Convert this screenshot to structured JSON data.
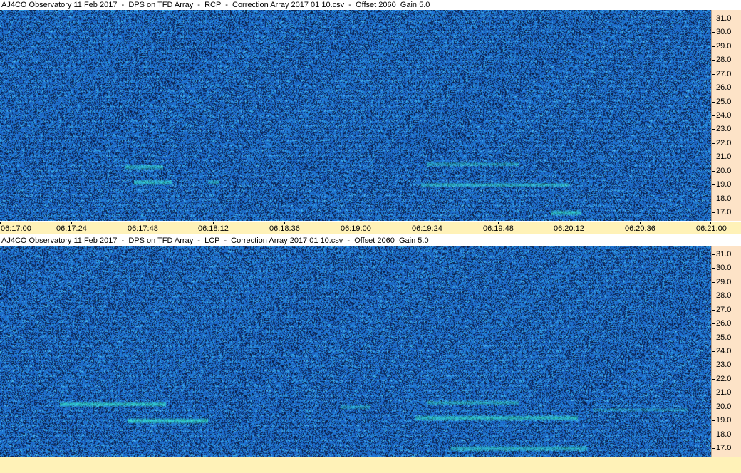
{
  "panels": [
    {
      "title": "AJ4CO Observatory 11 Feb 2017  -  DPS on TFD Array  -  RCP  -  Correction Array 2017 01 10.csv  -  Offset 2060  Gain 5.0",
      "polarization": "RCP",
      "show_time_labels": true,
      "bands": [
        {
          "freq": 20.3,
          "t_start": "06:17:42",
          "t_end": "06:17:55",
          "strength": 0.7
        },
        {
          "freq": 19.2,
          "t_start": "06:17:45",
          "t_end": "06:17:58",
          "strength": 0.8
        },
        {
          "freq": 19.2,
          "t_start": "06:18:10",
          "t_end": "06:18:14",
          "strength": 0.6
        },
        {
          "freq": 20.5,
          "t_start": "06:19:24",
          "t_end": "06:19:55",
          "strength": 0.5
        },
        {
          "freq": 19.0,
          "t_start": "06:19:22",
          "t_end": "06:20:12",
          "strength": 0.6
        },
        {
          "freq": 17.0,
          "t_start": "06:20:06",
          "t_end": "06:20:16",
          "strength": 0.8
        }
      ]
    },
    {
      "title": "AJ4CO Observatory 11 Feb 2017  -  DPS on TFD Array  -  LCP  -  Correction Array 2017 01 10.csv  -  Offset 2060  Gain 5.0",
      "polarization": "LCP",
      "show_time_labels": false,
      "bands": [
        {
          "freq": 20.2,
          "t_start": "06:17:20",
          "t_end": "06:17:56",
          "strength": 0.8
        },
        {
          "freq": 19.0,
          "t_start": "06:17:43",
          "t_end": "06:18:10",
          "strength": 0.9
        },
        {
          "freq": 20.0,
          "t_start": "06:18:55",
          "t_end": "06:19:05",
          "strength": 0.5
        },
        {
          "freq": 20.3,
          "t_start": "06:19:24",
          "t_end": "06:19:55",
          "strength": 0.6
        },
        {
          "freq": 19.2,
          "t_start": "06:19:20",
          "t_end": "06:20:15",
          "strength": 0.8
        },
        {
          "freq": 19.8,
          "t_start": "06:20:20",
          "t_end": "06:20:52",
          "strength": 0.4
        },
        {
          "freq": 17.0,
          "t_start": "06:19:32",
          "t_end": "06:20:18",
          "strength": 0.7
        }
      ]
    }
  ],
  "freq_axis": {
    "labels": [
      "31.0",
      "30.0",
      "29.0",
      "28.0",
      "27.0",
      "26.0",
      "25.0",
      "24.0",
      "23.0",
      "22.0",
      "21.0",
      "20.0",
      "19.0",
      "18.0",
      "17.0"
    ],
    "values": [
      31,
      30,
      29,
      28,
      27,
      26,
      25,
      24,
      23,
      22,
      21,
      20,
      19,
      18,
      17
    ],
    "range": [
      16.4,
      31.6
    ]
  },
  "time_axis": {
    "labels": [
      "06:17:00",
      "06:17:24",
      "06:17:48",
      "06:18:12",
      "06:18:36",
      "06:19:00",
      "06:19:24",
      "06:19:48",
      "06:20:12",
      "06:20:36",
      "06:21:00"
    ],
    "range": [
      "06:17:00",
      "06:21:00"
    ]
  },
  "colors": {
    "noise_dark": "#05102e",
    "noise_mid": "#1c5fc9",
    "noise_bright": "#27a6e8",
    "signal": "#3dffd0",
    "axis_bg": "#fde3c7",
    "time_bg": "#fff2b8"
  }
}
